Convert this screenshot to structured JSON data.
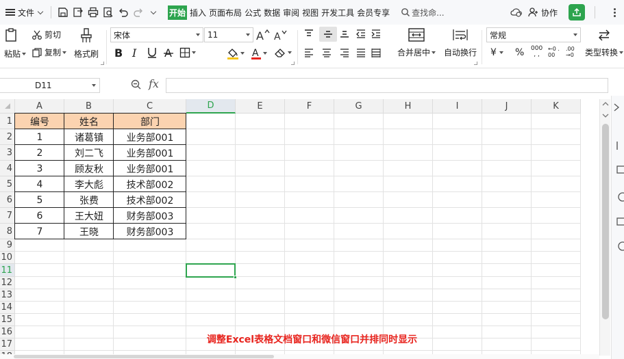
{
  "menubar": {
    "file_label": "文件",
    "tabs": [
      {
        "label": "开始",
        "active": true
      },
      {
        "label": "插入",
        "active": false
      },
      {
        "label": "页面布局",
        "active": false
      },
      {
        "label": "公式",
        "active": false
      },
      {
        "label": "数据",
        "active": false
      },
      {
        "label": "审阅",
        "active": false
      },
      {
        "label": "视图",
        "active": false
      },
      {
        "label": "开发工具",
        "active": false
      },
      {
        "label": "会员专享",
        "active": false
      }
    ],
    "search_placeholder": "查找命...",
    "collab_label": "协作",
    "accent_color": "#2da44e"
  },
  "ribbon": {
    "paste_label": "粘贴",
    "cut_label": "剪切",
    "copy_label": "复制",
    "format_painter_label": "格式刷",
    "font_name": "宋体",
    "font_size": "11",
    "merge_center_label": "合并居中",
    "wrap_text_label": "自动换行",
    "number_format": "常规",
    "currency_symbol": "¥",
    "percent_symbol": "%",
    "thousands_symbol": "000",
    "dec_inc_label": "←0 .00",
    "dec_dec_label": ".00 →0",
    "type_convert_label": "类型转换",
    "font_color": "#e8251f",
    "fill_color": "#f5c518"
  },
  "formula_bar": {
    "cell_ref": "D11",
    "fx_label": "fx",
    "formula_value": ""
  },
  "sheet": {
    "columns": [
      "A",
      "B",
      "C",
      "D",
      "E",
      "F",
      "G",
      "H",
      "I",
      "J",
      "K"
    ],
    "rows": [
      "1",
      "2",
      "3",
      "4",
      "5",
      "6",
      "7",
      "8",
      "9",
      "10",
      "11",
      "12",
      "13",
      "14",
      "15",
      "16",
      "17",
      "18"
    ],
    "selected_column": "D",
    "selected_row": "11",
    "header_fill": "#fbd3b0",
    "table_header": [
      "编号",
      "姓名",
      "部门"
    ],
    "table_rows": [
      [
        "1",
        "诸葛镇",
        "业务部001"
      ],
      [
        "2",
        "刘二飞",
        "业务部001"
      ],
      [
        "3",
        "顾友秋",
        "业务部001"
      ],
      [
        "4",
        "李大彪",
        "技术部002"
      ],
      [
        "5",
        "张费",
        "技术部002"
      ],
      [
        "6",
        "王大妞",
        "财务部003"
      ],
      [
        "7",
        "王晓",
        "财务部003"
      ]
    ]
  },
  "caption": "调整Excel表格文档窗口和微信窗口并排同时显示"
}
